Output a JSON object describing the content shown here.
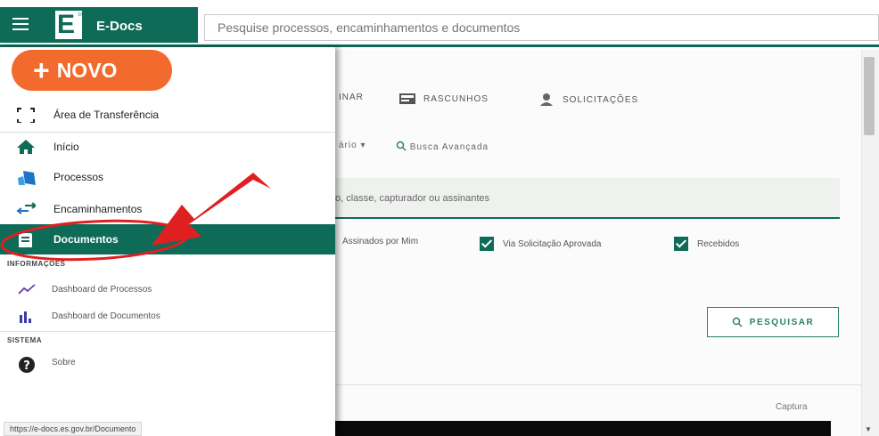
{
  "header": {
    "app_title": "E-Docs",
    "logo_letter": "E",
    "logo_mini": "DOCS",
    "search_placeholder": "Pesquise processos, encaminhamentos e documentos"
  },
  "drawer": {
    "new_button": "NOVO",
    "items": [
      {
        "label": "Área de Transferência",
        "icon": "clipboard-icon"
      },
      {
        "label": "Início",
        "icon": "home-icon"
      },
      {
        "label": "Processos",
        "icon": "processes-icon"
      },
      {
        "label": "Encaminhamentos",
        "icon": "forward-icon"
      },
      {
        "label": "Documentos",
        "icon": "document-icon",
        "active": true
      }
    ],
    "sections": {
      "informacoes": "INFORMAÇÕES",
      "sistema": "SISTEMA"
    },
    "info_items": [
      {
        "label": "Dashboard de Processos",
        "icon": "line-chart-icon"
      },
      {
        "label": "Dashboard de Documentos",
        "icon": "bar-chart-icon"
      }
    ],
    "system_items": [
      {
        "label": "Sobre",
        "icon": "help-icon"
      }
    ]
  },
  "main": {
    "tabs": [
      {
        "label": "INAR"
      },
      {
        "label": "RASCUNHOS",
        "icon": "drafts-icon"
      },
      {
        "label": "SOLICITAÇÕES",
        "icon": "requests-icon"
      }
    ],
    "crumb_fragment": "ário",
    "advanced_search": "Busca Avançada",
    "search_field_placeholder": "o, classe, capturador ou assinantes",
    "filters": [
      {
        "label": "Assinados por Mim",
        "checked": false
      },
      {
        "label": "Via Solicitação Aprovada",
        "checked": true
      },
      {
        "label": "Recebidos",
        "checked": true
      }
    ],
    "search_button": "PESQUISAR",
    "column_header": "Captura"
  },
  "statusbar": {
    "url": "https://e-docs.es.gov.br/Documento"
  },
  "colors": {
    "primary": "#0e6b57",
    "accent": "#f26a2e",
    "annotation": "#e02020"
  }
}
